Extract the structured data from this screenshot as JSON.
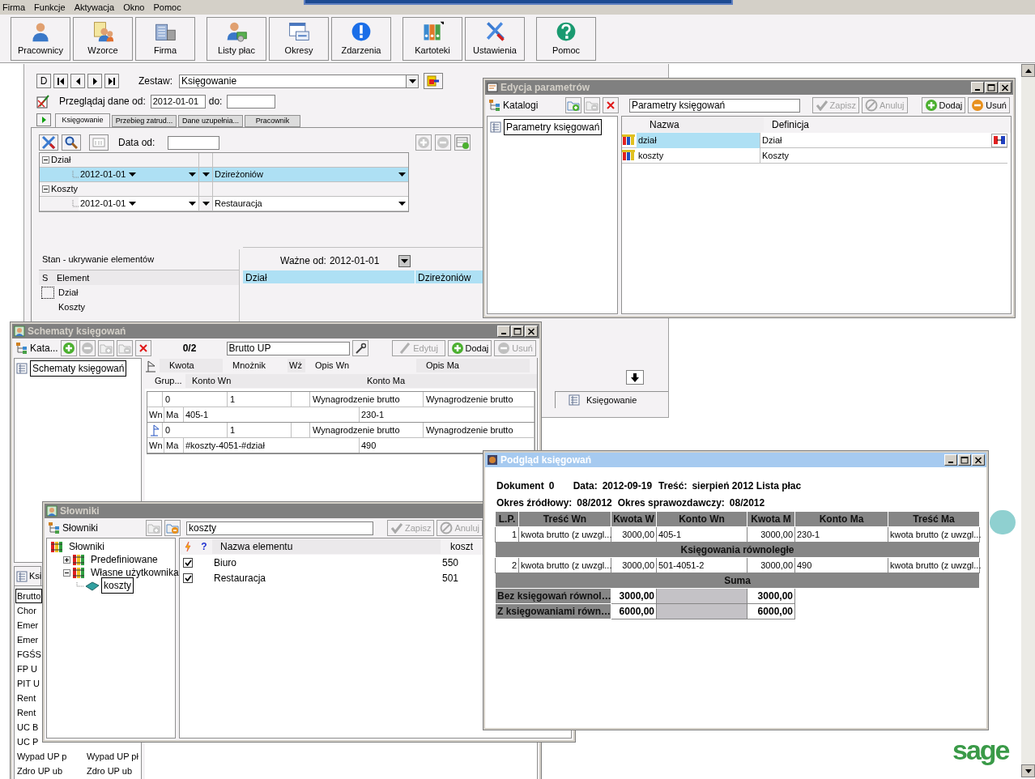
{
  "menu": [
    {
      "label": "Firma"
    },
    {
      "label": "Funkcje"
    },
    {
      "label": "Aktywacja"
    },
    {
      "label": "Okno"
    },
    {
      "label": "Pomoc"
    }
  ],
  "toolbar_groups": [
    [
      {
        "label": "Pracownicy",
        "kind": "person"
      },
      {
        "label": "Wzorce",
        "kind": "templates"
      },
      {
        "label": "Firma",
        "kind": "building"
      }
    ],
    [
      {
        "label": "Listy płac",
        "kind": "payroll"
      },
      {
        "label": "Okresy",
        "kind": "calendar"
      },
      {
        "label": "Zdarzenia",
        "kind": "alert"
      }
    ],
    [
      {
        "label": "Kartoteki",
        "kind": "binders"
      },
      {
        "label": "Ustawienia",
        "kind": "tools"
      }
    ],
    [
      {
        "label": "Pomoc",
        "kind": "help"
      }
    ]
  ],
  "main_window": {
    "nav_first": "D",
    "zestaw_label": "Zestaw:",
    "zestaw_value": "Księgowanie",
    "browse_label": "Przeglądaj dane od:",
    "browse_from": "2012-01-01",
    "browse_to_label": "do:",
    "tabs": [
      {
        "label": "Księgowanie",
        "selected": true
      },
      {
        "label": "Przebieg zatrud...",
        "selected": false
      },
      {
        "label": "Dane uzupełnia...",
        "selected": false
      },
      {
        "label": "Pracownik",
        "selected": false
      }
    ],
    "date_label": "Data od:",
    "parameter_groups": [
      {
        "name": "Dział",
        "expanded": true,
        "rows": [
          {
            "date": "2012-01-01",
            "value": "Dzireżoniów",
            "selected": true
          }
        ]
      },
      {
        "name": "Koszty",
        "expanded": true,
        "rows": [
          {
            "date": "2012-01-01",
            "value": "Restauracja",
            "selected": false
          }
        ]
      }
    ],
    "state_panel": {
      "title": "Stan - ukrywanie elementów",
      "columns": [
        "S",
        "Element"
      ],
      "items": [
        {
          "label": "Dział",
          "focused": true
        },
        {
          "label": "Koszty",
          "focused": false
        }
      ]
    },
    "valid_panel": {
      "label": "Ważne od:",
      "value": "2012-01-01",
      "rows": [
        {
          "element": "Dział",
          "value": "Dzireżoniów",
          "selected": true
        }
      ]
    },
    "bottom_tab": "Księgowanie"
  },
  "parameters_window": {
    "title": "Edycja parametrów",
    "active": false,
    "tree_label": "Katalogi",
    "search": "Parametry księgowań",
    "buttons": [
      {
        "label": "Zapisz",
        "kind": "save",
        "disabled": true
      },
      {
        "label": "Anuluj",
        "kind": "cancel",
        "disabled": true
      },
      {
        "label": "Dodaj",
        "kind": "add",
        "disabled": false
      },
      {
        "label": "Usuń",
        "kind": "remove",
        "disabled": false
      }
    ],
    "tree": [
      {
        "label": "Parametry księgowań",
        "selected": true
      }
    ],
    "columns": [
      "Nazwa",
      "Definicja"
    ],
    "rows": [
      {
        "name": "dział",
        "definition": "Dział",
        "selected": true
      },
      {
        "name": "koszty",
        "definition": "Koszty",
        "selected": false
      }
    ]
  },
  "schemes_window": {
    "title": "Schematy księgowań",
    "active": false,
    "tree_label": "Kata...",
    "counter": "0/2",
    "search": "Brutto UP",
    "buttons": [
      {
        "label": "Edytuj",
        "kind": "edit",
        "disabled": true
      },
      {
        "label": "Dodaj",
        "kind": "add",
        "disabled": false
      },
      {
        "label": "Usuń",
        "kind": "remove",
        "disabled": true
      }
    ],
    "tree": [
      {
        "label": "Schematy księgowań",
        "selected": true
      }
    ],
    "header_row_1": [
      "Kwota",
      "Mnożnik",
      "Wż",
      "Opis Wn",
      "Opis Ma"
    ],
    "header_row_2": [
      "Grup...",
      "Konto Wn",
      "Konto Ma"
    ],
    "records": [
      {
        "flagged": false,
        "amount": "0",
        "multiplier": "1",
        "desc_wn": "Wynagrodzenie brutto",
        "desc_ma": "Wynagrodzenie brutto",
        "wn_label": "Wn",
        "ma_label": "Ma",
        "account_wn": "405-1",
        "account_ma": "230-1"
      },
      {
        "flagged": true,
        "amount": "0",
        "multiplier": "1",
        "desc_wn": "Wynagrodzenie brutto",
        "desc_ma": "Wynagrodzenie brutto",
        "wn_label": "Wn",
        "ma_label": "Ma",
        "account_wn": "#koszty-4051-#dział",
        "account_ma": "490"
      }
    ],
    "list_tab": "Ksi",
    "list": [
      {
        "column_1": "Brutto",
        "selected": true
      },
      {
        "column_1": "Chor",
        "selected": false
      },
      {
        "column_1": "Emer",
        "selected": false
      },
      {
        "column_1": "Emer",
        "selected": false
      },
      {
        "column_1": "FGŚS",
        "selected": false
      },
      {
        "column_1": "FP U",
        "selected": false
      },
      {
        "column_1": "PIT U",
        "selected": false
      },
      {
        "column_1": "Rent",
        "selected": false
      },
      {
        "column_1": "Rent",
        "selected": false
      },
      {
        "column_1": "UC B",
        "selected": false
      },
      {
        "column_1": "UC P",
        "selected": false
      },
      {
        "column_1": "Wypad UP p",
        "column_2": "Wypad UP pł",
        "selected": false
      },
      {
        "column_1": "Zdro UP ub",
        "column_2": "Zdro UP ub",
        "selected": false
      }
    ]
  },
  "dictionaries_window": {
    "title": "Słowniki",
    "active": false,
    "tree_label": "Słowniki",
    "search": "koszty",
    "buttons": [
      {
        "label": "Zapisz",
        "kind": "save",
        "disabled": true
      },
      {
        "label": "Anuluj",
        "kind": "cancel",
        "disabled": true
      }
    ],
    "tree": [
      {
        "label": "Słowniki",
        "expanded": true,
        "selected": false,
        "children": [
          {
            "label": "Predefiniowane",
            "expanded": false,
            "selected": false
          },
          {
            "label": "Własne użytkownika",
            "expanded": true,
            "selected": false,
            "children": [
              {
                "label": "koszty",
                "selected": true
              }
            ]
          }
        ]
      }
    ],
    "help_column": "?",
    "name_column": "Nazwa elementu",
    "column_4": "koszt",
    "rows": [
      {
        "checked": true,
        "name": "Biuro",
        "value": "550"
      },
      {
        "checked": true,
        "name": "Restauracja",
        "value": "501"
      }
    ]
  },
  "preview_window": {
    "title": "Podgląd księgowań",
    "active": true,
    "document_label": "Dokument",
    "document": "0",
    "date_label": "Data:",
    "date": "2012-09-19",
    "content_label": "Treść:",
    "content": "sierpień 2012 Lista płac",
    "source_period_label": "Okres źródłowy:",
    "source_period": "08/2012",
    "report_period_label": "Okres sprawozdawczy:",
    "report_period": "08/2012",
    "columns": [
      "L.P.",
      "Treść Wn",
      "Kwota W",
      "Konto Wn",
      "Kwota M",
      "Konto Ma",
      "Treść Ma"
    ],
    "rows": [
      {
        "kind": "entry",
        "cells": [
          "1",
          "kwota brutto (z uwzgl...",
          "3000,00",
          "405-1",
          "3000,00",
          "230-1",
          "kwota brutto (z uwzgl..."
        ]
      },
      {
        "kind": "section",
        "label": "Księgowania równoległe"
      },
      {
        "kind": "entry",
        "cells": [
          "2",
          "kwota brutto (z uwzgl...",
          "3000,00",
          "501-4051-2",
          "3000,00",
          "490",
          "kwota brutto (z uwzgl..."
        ]
      },
      {
        "kind": "section",
        "label": "Suma"
      },
      {
        "kind": "sum",
        "label": "Bez księgowań równol…",
        "amount_w": "3000,00",
        "amount_m": "3000,00"
      },
      {
        "kind": "sum",
        "label": "Z księgowaniami równ…",
        "amount_w": "6000,00",
        "amount_m": "6000,00"
      }
    ]
  },
  "logo_text": "sage"
}
